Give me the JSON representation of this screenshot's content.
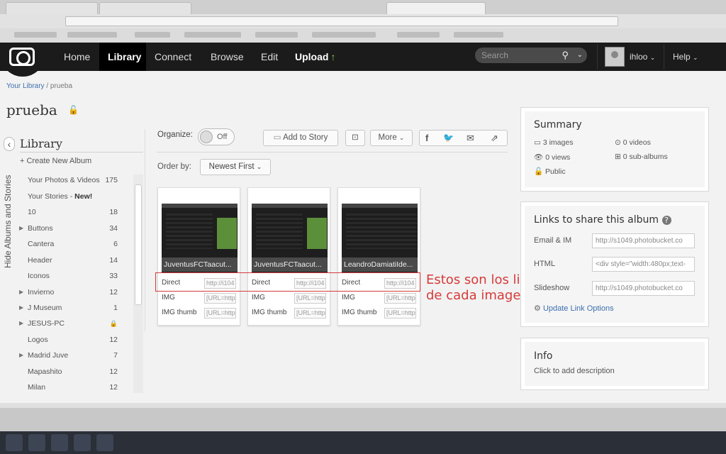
{
  "nav": {
    "home": "Home",
    "library": "Library",
    "connect": "Connect",
    "browse": "Browse",
    "edit": "Edit",
    "upload": "Upload",
    "search_placeholder": "Search",
    "user": "ihloo",
    "help": "Help"
  },
  "breadcrumb": {
    "root": "Your Library",
    "sep": "/",
    "current": "prueba"
  },
  "album_title": "prueba",
  "sidebar": {
    "hide_label": "Hide Albums and Stories",
    "title": "Library",
    "create": "+ Create New Album",
    "items": [
      {
        "name": "Your Photos & Videos",
        "count": "175"
      },
      {
        "name": "Your Stories - ",
        "badge": "New!",
        "count": ""
      },
      {
        "name": "10",
        "count": "18"
      },
      {
        "name": "Buttons",
        "count": "34"
      },
      {
        "name": "Cantera",
        "count": "6"
      },
      {
        "name": "Header",
        "count": "14"
      },
      {
        "name": "Iconos",
        "count": "33"
      },
      {
        "name": "Invierno",
        "count": "12"
      },
      {
        "name": "J Museum",
        "count": "1"
      },
      {
        "name": "JESUS-PC",
        "count": ""
      },
      {
        "name": "Logos",
        "count": "12"
      },
      {
        "name": "Madrid Juve",
        "count": "7"
      },
      {
        "name": "Mapashito",
        "count": "12"
      },
      {
        "name": "Milan",
        "count": "12"
      }
    ]
  },
  "toolbar": {
    "organize": "Organize:",
    "toggle": "Off",
    "add_story": "Add to Story",
    "more": "More",
    "order_by": "Order by:",
    "order_value": "Newest First"
  },
  "cards": [
    {
      "caption": "JuventusFCTaacut...",
      "direct": "Direct",
      "direct_val": "http://i104",
      "img": "IMG",
      "img_val": "[URL=http",
      "thumb": "IMG thumb",
      "thumb_val": "[URL=http"
    },
    {
      "caption": "JuventusFCTaacut...",
      "direct": "Direct",
      "direct_val": "http://i104",
      "img": "IMG",
      "img_val": "[URL=http",
      "thumb": "IMG thumb",
      "thumb_val": "[URL=http"
    },
    {
      "caption": "LeandroDamiatiIde...",
      "direct": "Direct",
      "direct_val": "http://i104",
      "img": "IMG",
      "img_val": "[URL=http",
      "thumb": "IMG thumb",
      "thumb_val": "[URL=http"
    }
  ],
  "annotation": {
    "line1": "Estos son los links directos",
    "line2": "de cada imagen."
  },
  "summary": {
    "title": "Summary",
    "images": "3 images",
    "videos": "0 videos",
    "views": "0 views",
    "subalbums": "0 sub-albums",
    "privacy": "Public"
  },
  "links": {
    "title": "Links to share this album",
    "email_label": "Email & IM",
    "email_val": "http://s1049.photobucket.co",
    "html_label": "HTML",
    "html_val": "<div style=\"width:480px;text-",
    "slideshow_label": "Slideshow",
    "slideshow_val": "http://s1049.photobucket.co",
    "update": "Update Link Options"
  },
  "info": {
    "title": "Info",
    "desc": "Click to add description"
  },
  "colors": {
    "accent": "#3b6fae",
    "annotation": "#d63a3a",
    "nav_bg": "#1b1b1b",
    "upload_arrow": "#8cc63f"
  }
}
